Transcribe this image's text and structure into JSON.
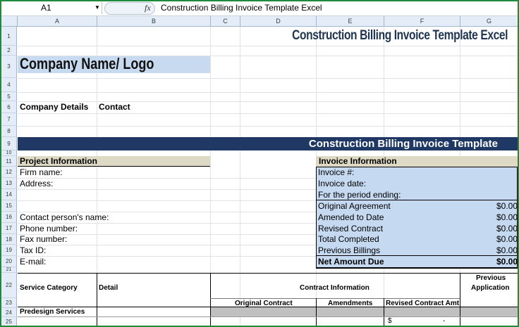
{
  "formula_bar": {
    "name_box": "A1",
    "fx_label": "fx",
    "formula": "Construction Billing Invoice Template Excel"
  },
  "columns": [
    "A",
    "B",
    "C",
    "D",
    "E",
    "F",
    "G"
  ],
  "rows": [
    "1",
    "2",
    "3",
    "4",
    "5",
    "6",
    "7",
    "8",
    "9",
    "10",
    "11",
    "12",
    "13",
    "14",
    "15",
    "16",
    "17",
    "18",
    "19",
    "20",
    "21",
    "22",
    "23",
    "24",
    "25"
  ],
  "sheet": {
    "title": "Construction Billing Invoice Template Excel",
    "company_name": "Company Name/ Logo",
    "company_details": "Company Details",
    "contact": "Contact",
    "banner": "Construction Billing Invoice Template",
    "project_info": {
      "header": "Project Information",
      "fields": [
        "Firm name:",
        "Address:",
        "Contact person's name:",
        "Phone number:",
        "Fax number:",
        "Tax ID:",
        "E-mail:"
      ]
    },
    "invoice_info": {
      "header": "Invoice Information",
      "fields": [
        "Invoice #:",
        "Invoice date:",
        "For the period ending:"
      ],
      "amounts": [
        {
          "label": "Original Agreement",
          "value": "$0.00"
        },
        {
          "label": "Amended to Date",
          "value": "$0.00"
        },
        {
          "label": "Revised Contract",
          "value": "$0.00"
        },
        {
          "label": "Total Completed",
          "value": "$0.00"
        },
        {
          "label": "Previous Billings",
          "value": "$0.00"
        }
      ],
      "net_label": "Net Amount Due",
      "net_value": "$0.00"
    },
    "table": {
      "service_category": "Service Category",
      "detail": "Detail",
      "contract_information": "Contract Information",
      "previous_application": "Previous Application",
      "original_contract": "Original Contract",
      "amendments": "Amendments",
      "revised_contract_amt": "Revised Contract Amt",
      "predesign": "Predesign Services",
      "currency": "$",
      "dash": "-"
    }
  },
  "colors": {
    "banner": "#1f3864",
    "tan": "#ddd9c4",
    "light_blue": "#c5d9f1",
    "frame": "#1f8a3a"
  }
}
